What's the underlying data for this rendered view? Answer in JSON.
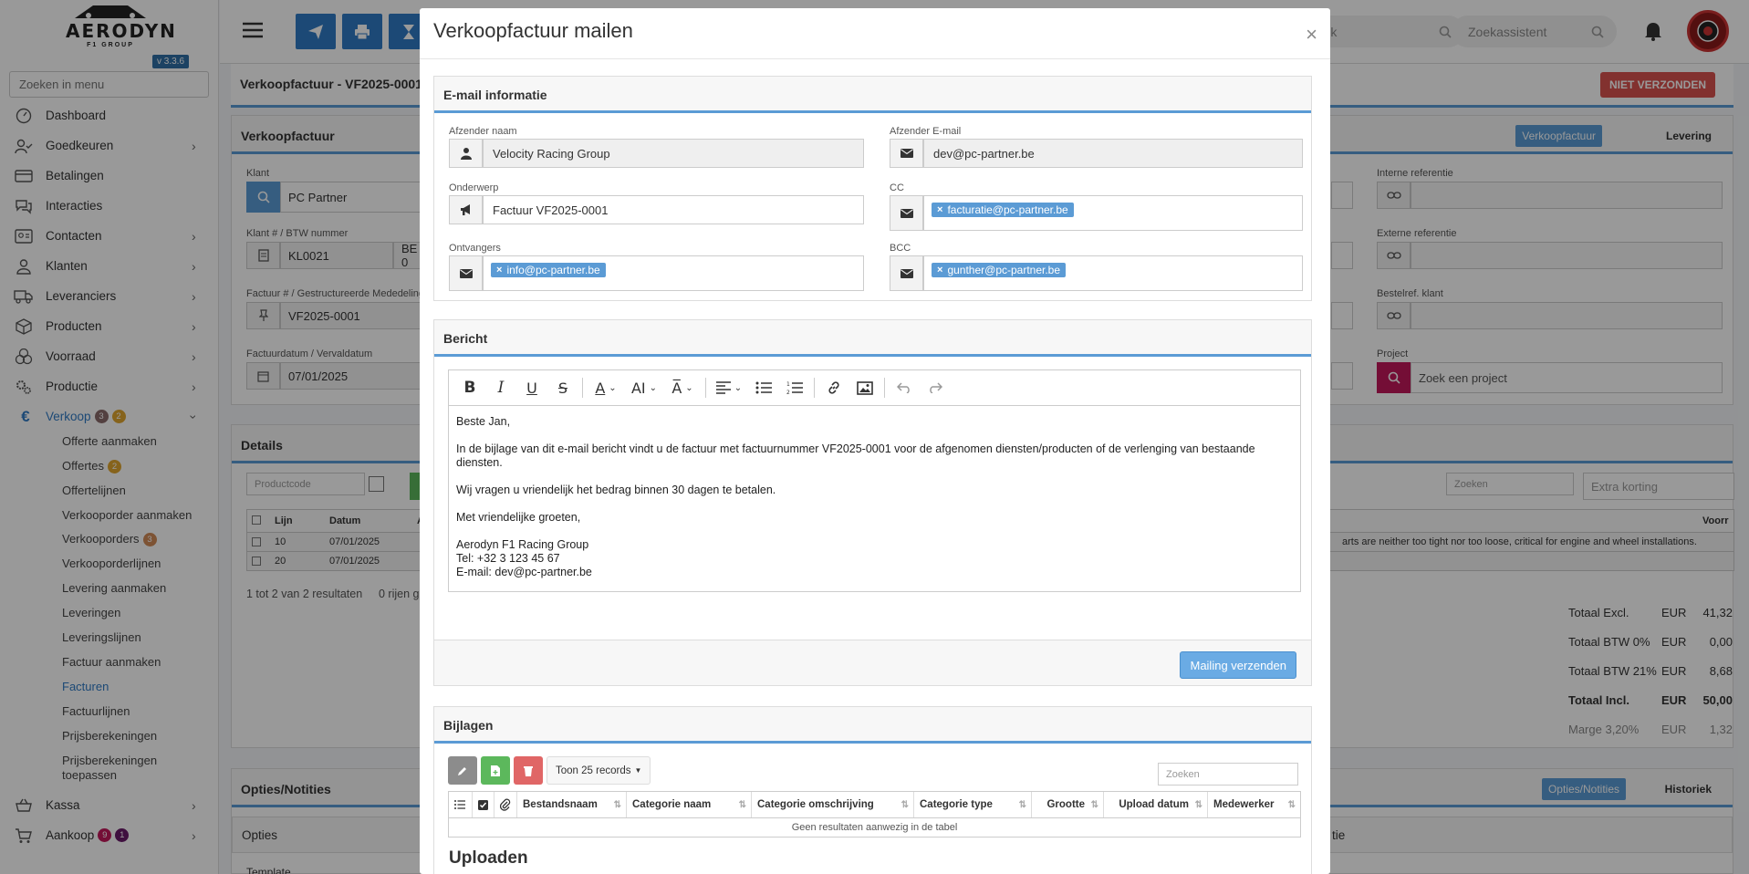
{
  "app": {
    "logo_text": "AERODYN",
    "logo_sub": "F1 GROUP",
    "version": "v 3.3.6",
    "menu_search_placeholder": "Zoeken in menu"
  },
  "sidebar": {
    "items": [
      {
        "label": "Dashboard",
        "icon": "dashboard-icon"
      },
      {
        "label": "Goedkeuren",
        "icon": "approve-icon",
        "chevron": true
      },
      {
        "label": "Betalingen",
        "icon": "payments-icon"
      },
      {
        "label": "Interacties",
        "icon": "chat-icon"
      },
      {
        "label": "Contacten",
        "icon": "contacts-icon",
        "chevron": true
      },
      {
        "label": "Klanten",
        "icon": "customer-icon",
        "chevron": true
      },
      {
        "label": "Leveranciers",
        "icon": "truck-icon",
        "chevron": true
      },
      {
        "label": "Producten",
        "icon": "box-icon",
        "chevron": true
      },
      {
        "label": "Voorraad",
        "icon": "stock-icon",
        "chevron": true
      },
      {
        "label": "Productie",
        "icon": "gears-icon",
        "chevron": true
      },
      {
        "label": "Verkoop",
        "icon": "euro-icon",
        "chevron": true,
        "badges": [
          "3",
          "2"
        ]
      }
    ],
    "verkoop_sub": [
      {
        "label": "Offerte aanmaken"
      },
      {
        "label": "Offertes",
        "badge": "2"
      },
      {
        "label": "Offertelijnen"
      },
      {
        "label": "Verkooporder aanmaken"
      },
      {
        "label": "Verkooporders",
        "badge": "3"
      },
      {
        "label": "Verkooporderlijnen"
      },
      {
        "label": "Levering aanmaken"
      },
      {
        "label": "Leveringen"
      },
      {
        "label": "Leveringslijnen"
      },
      {
        "label": "Factuur aanmaken"
      },
      {
        "label": "Facturen"
      },
      {
        "label": "Factuurlijnen"
      },
      {
        "label": "Prijsberekeningen"
      },
      {
        "label": "Prijsberekeningen",
        "label2": "toepassen"
      }
    ],
    "bottom": [
      {
        "label": "Kassa",
        "icon": "cart-icon"
      },
      {
        "label": "Aankoop",
        "icon": "shopping-cart-icon",
        "badges": [
          "9",
          "1"
        ]
      }
    ]
  },
  "topbar": {
    "search1_placeholder": "boek",
    "search2_placeholder": "Zoekassistent"
  },
  "background": {
    "page_title": "Verkoopfactuur - VF2025-0001",
    "status": "NIET VERZONDEN",
    "card_title": "Verkoopfactuur",
    "tabs": [
      "Verkoopfactuur",
      "Levering"
    ],
    "klant_label": "Klant",
    "klant_value": "PC Partner",
    "klantnr_label": "Klant # / BTW nummer",
    "klantnr_value": "KL0021",
    "btw_value": "BE 0",
    "factuur_label": "Factuur # / Gestructureerde Mededeling",
    "factuur_value": "VF2025-0001",
    "datum_label": "Factuurdatum / Vervaldatum",
    "datum_value": "07/01/2025",
    "interne_ref": "Interne referentie",
    "externe_ref": "Externe referentie",
    "bestelref": "Bestelref. klant",
    "project": "Project",
    "project_placeholder": "Zoek een project",
    "details": "Details",
    "productcode_placeholder": "Productcode",
    "zoeken_placeholder": "Zoeken",
    "extra_korting_placeholder": "Extra korting",
    "table_headers": [
      "Lijn",
      "Datum",
      "A",
      "Voorr"
    ],
    "rows": [
      {
        "lijn": "10",
        "datum": "07/01/2025"
      },
      {
        "lijn": "20",
        "datum": "07/01/2025"
      }
    ],
    "row_note": "arts are neither too tight nor too loose, critical for engine and wheel installations.",
    "result_text": "1 tot 2 van 2 resultaten",
    "rows_text": "0 rijen g",
    "totals": [
      {
        "label": "Totaal Excl.",
        "cur": "EUR",
        "value": "41,32",
        "bold": false
      },
      {
        "label": "Totaal BTW 0%",
        "cur": "EUR",
        "value": "0,00",
        "bold": false
      },
      {
        "label": "Totaal BTW 21%",
        "cur": "EUR",
        "value": "8,68",
        "bold": false
      },
      {
        "label": "Totaal Incl.",
        "cur": "EUR",
        "value": "50,00",
        "bold": true
      },
      {
        "label": "Marge 3,20%",
        "cur": "EUR",
        "value": "1,32",
        "bold": false
      }
    ],
    "opties_title": "Opties/Notities",
    "opties_tabs": [
      "Opties/Notities",
      "Historiek"
    ],
    "opties_sub": "Opties",
    "template_label": "Template",
    "tie": "tie"
  },
  "modal": {
    "title": "Verkoopfactuur mailen",
    "email_section": "E-mail informatie",
    "afzender_naam_label": "Afzender naam",
    "afzender_naam": "Velocity Racing Group",
    "afzender_email_label": "Afzender E-mail",
    "afzender_email": "dev@pc-partner.be",
    "onderwerp_label": "Onderwerp",
    "onderwerp": "Factuur VF2025-0001",
    "cc_label": "CC",
    "cc_tag": "facturatie@pc-partner.be",
    "ontvangers_label": "Ontvangers",
    "ontvangers_tag": "info@pc-partner.be",
    "bcc_label": "BCC",
    "bcc_tag": "gunther@pc-partner.be",
    "bericht_section": "Bericht",
    "message": {
      "greeting": "Beste Jan,",
      "p1": "In de bijlage van dit e-mail bericht vindt u de factuur met factuurnummer VF2025-0001 voor de afgenomen diensten/producten of de verlenging van bestaande diensten.",
      "p2": "Wij vragen u vriendelijk het bedrag binnen 30 dagen te betalen.",
      "closing": "Met vriendelijke groeten,",
      "sig_company": "Aerodyn F1 Racing Group",
      "sig_tel": "Tel: +32 3 123 45 67",
      "sig_email": "E-mail: dev@pc-partner.be"
    },
    "send_button": "Mailing verzenden",
    "bijlagen_section": "Bijlagen",
    "toon_records": "Toon 25 records",
    "bijlagen_search_placeholder": "Zoeken",
    "attach_headers": [
      "Bestandsnaam",
      "Categorie naam",
      "Categorie omschrijving",
      "Categorie type",
      "Grootte",
      "Upload datum",
      "Medewerker"
    ],
    "empty_text": "Geen resultaten aanwezig in de tabel",
    "upload_title": "Uploaden"
  },
  "colors": {
    "primary": "#2f7ac5",
    "accent_line": "#5b9bd5",
    "danger": "#d9534f",
    "success": "#5cb85c",
    "gray_btn": "#8c8c8c"
  }
}
